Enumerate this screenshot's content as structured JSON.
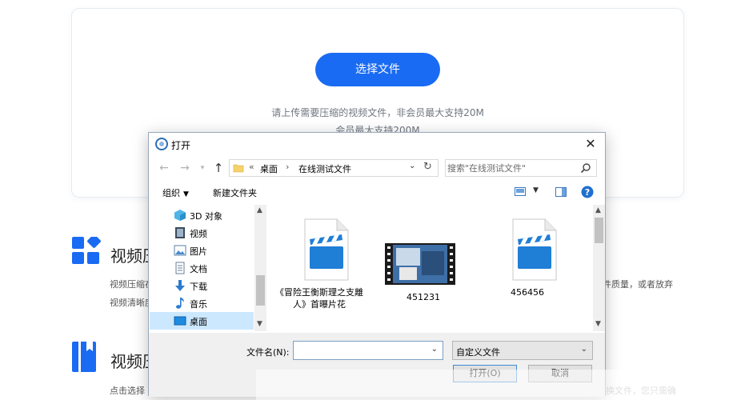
{
  "page": {
    "choose_button": "选择文件",
    "hint_line1": "请上传需要压缩的视频文件，非会员最大支持20M",
    "hint_line2": "会员最大支持200M",
    "feature1": {
      "title": "视频压",
      "desc_line1": "视频压缩在",
      "desc_line2": "视频清晰度",
      "desc_tail": "件质量，或者放弃"
    },
    "feature2": {
      "title": "视频压",
      "desc_line1": "点击选择",
      "desc_tail": "换文件，您只需确"
    }
  },
  "dialog": {
    "title": "打开",
    "breadcrumb": [
      "«",
      "桌面",
      "›",
      "在线测试文件"
    ],
    "search_placeholder": "搜索\"在线测试文件\"",
    "toolbar": {
      "organize": "组织",
      "new_folder": "新建文件夹"
    },
    "sidebar": [
      {
        "label": "3D 对象",
        "icon": "3d-objects-icon"
      },
      {
        "label": "视频",
        "icon": "videos-icon"
      },
      {
        "label": "图片",
        "icon": "pictures-icon"
      },
      {
        "label": "文档",
        "icon": "documents-icon"
      },
      {
        "label": "下载",
        "icon": "downloads-icon"
      },
      {
        "label": "音乐",
        "icon": "music-icon"
      },
      {
        "label": "桌面",
        "icon": "desktop-icon",
        "selected": true
      }
    ],
    "files": [
      {
        "name": "《冒险王衡斯理之支離人》首曝片花",
        "type": "video-file-icon"
      },
      {
        "name": "451231",
        "type": "video-thumbnail"
      },
      {
        "name": "456456",
        "type": "video-file-icon"
      }
    ],
    "footer": {
      "filename_label": "文件名(N):",
      "filename_value": "",
      "filter_value": "自定义文件",
      "open_button": "打开(O)",
      "cancel_button": "取消"
    }
  },
  "colors": {
    "accent": "#1a6bf3",
    "selection": "#cce8ff",
    "clapper": "#1f7ed6"
  }
}
